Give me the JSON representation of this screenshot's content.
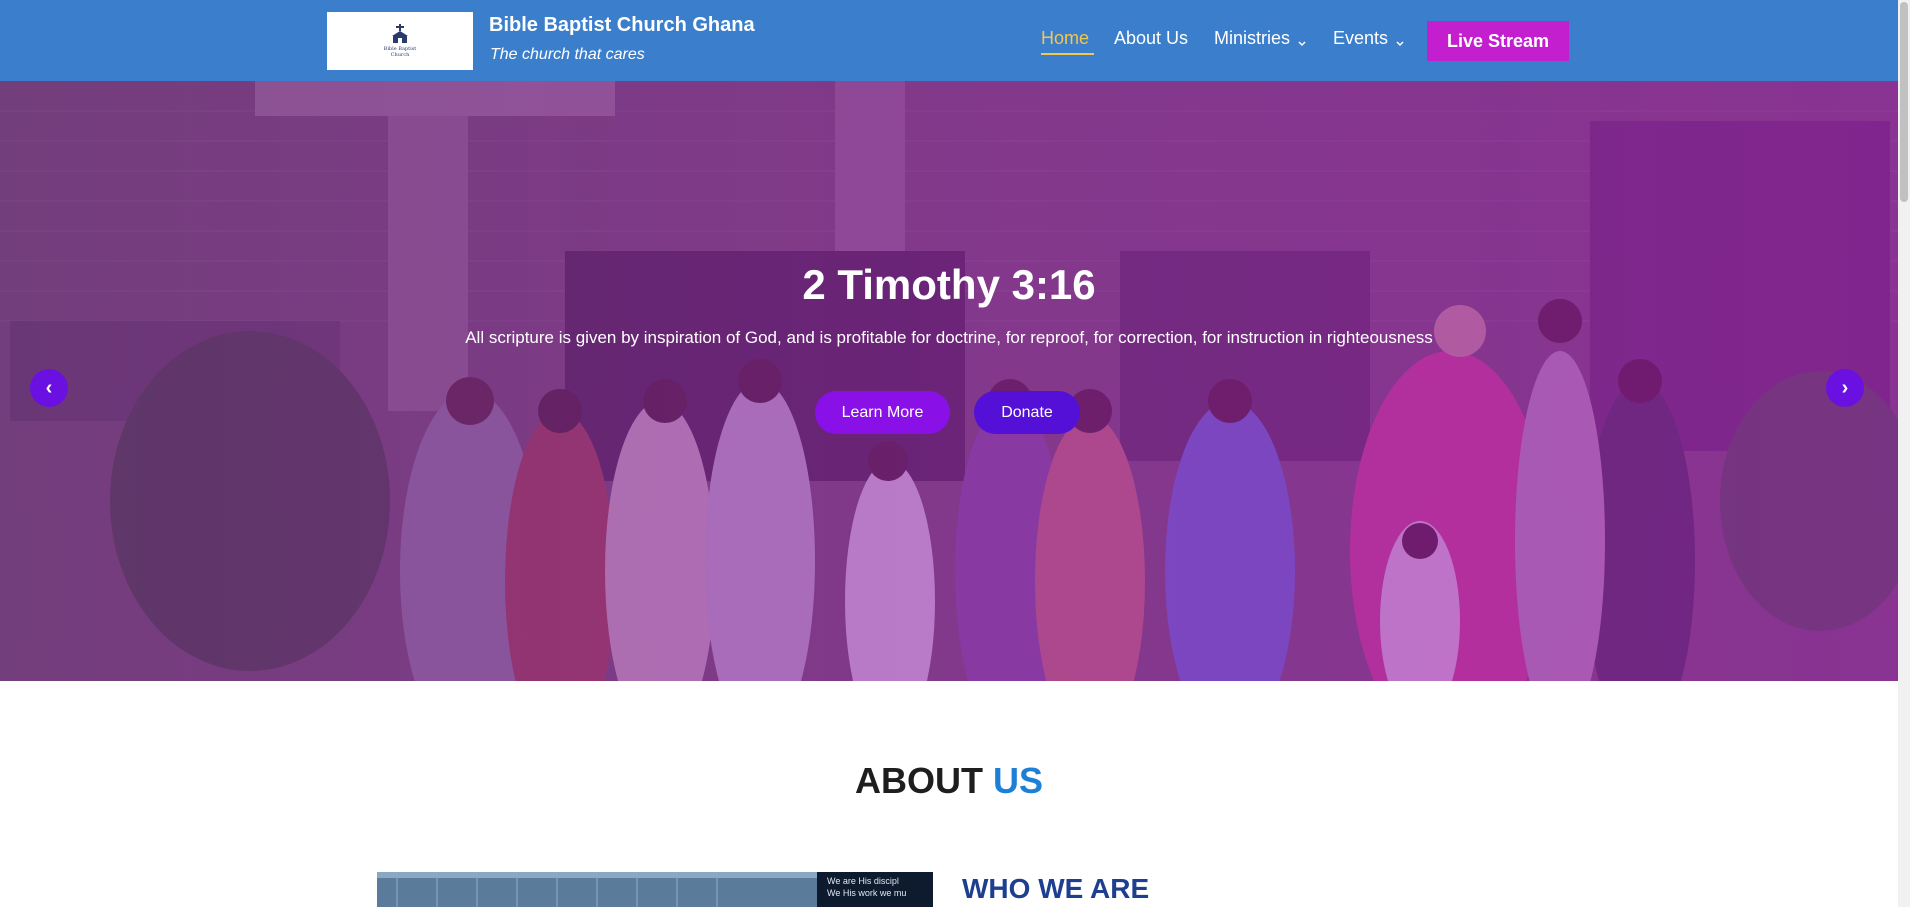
{
  "header": {
    "logo_text": "Bible Baptist Church",
    "site_title": "Bible Baptist Church Ghana",
    "tagline": "The church that cares",
    "nav": {
      "home": "Home",
      "about": "About Us",
      "ministries": "Ministries",
      "events": "Events"
    },
    "live_stream": "Live Stream"
  },
  "hero": {
    "title": "2 Timothy 3:16",
    "text": "All scripture is given by inspiration of God, and is profitable for doctrine, for reproof, for correction, for instruction in righteousness",
    "learn_more": "Learn More",
    "donate": "Donate",
    "prev_glyph": "‹",
    "next_glyph": "›"
  },
  "about": {
    "heading_main": "ABOUT ",
    "heading_accent": "US",
    "image_caption_1": "We are His discipl",
    "image_caption_2": "We His work we mu",
    "who_we_are": "WHO WE ARE"
  },
  "colors": {
    "header_bg": "#3b7fcc",
    "active_nav": "#f3c64c",
    "live_stream_bg": "#c41fcf",
    "learn_more_bg": "#8a10e8",
    "donate_bg": "#5510d8",
    "about_accent": "#1e7fd6",
    "who_we_are": "#1e3f8f"
  }
}
